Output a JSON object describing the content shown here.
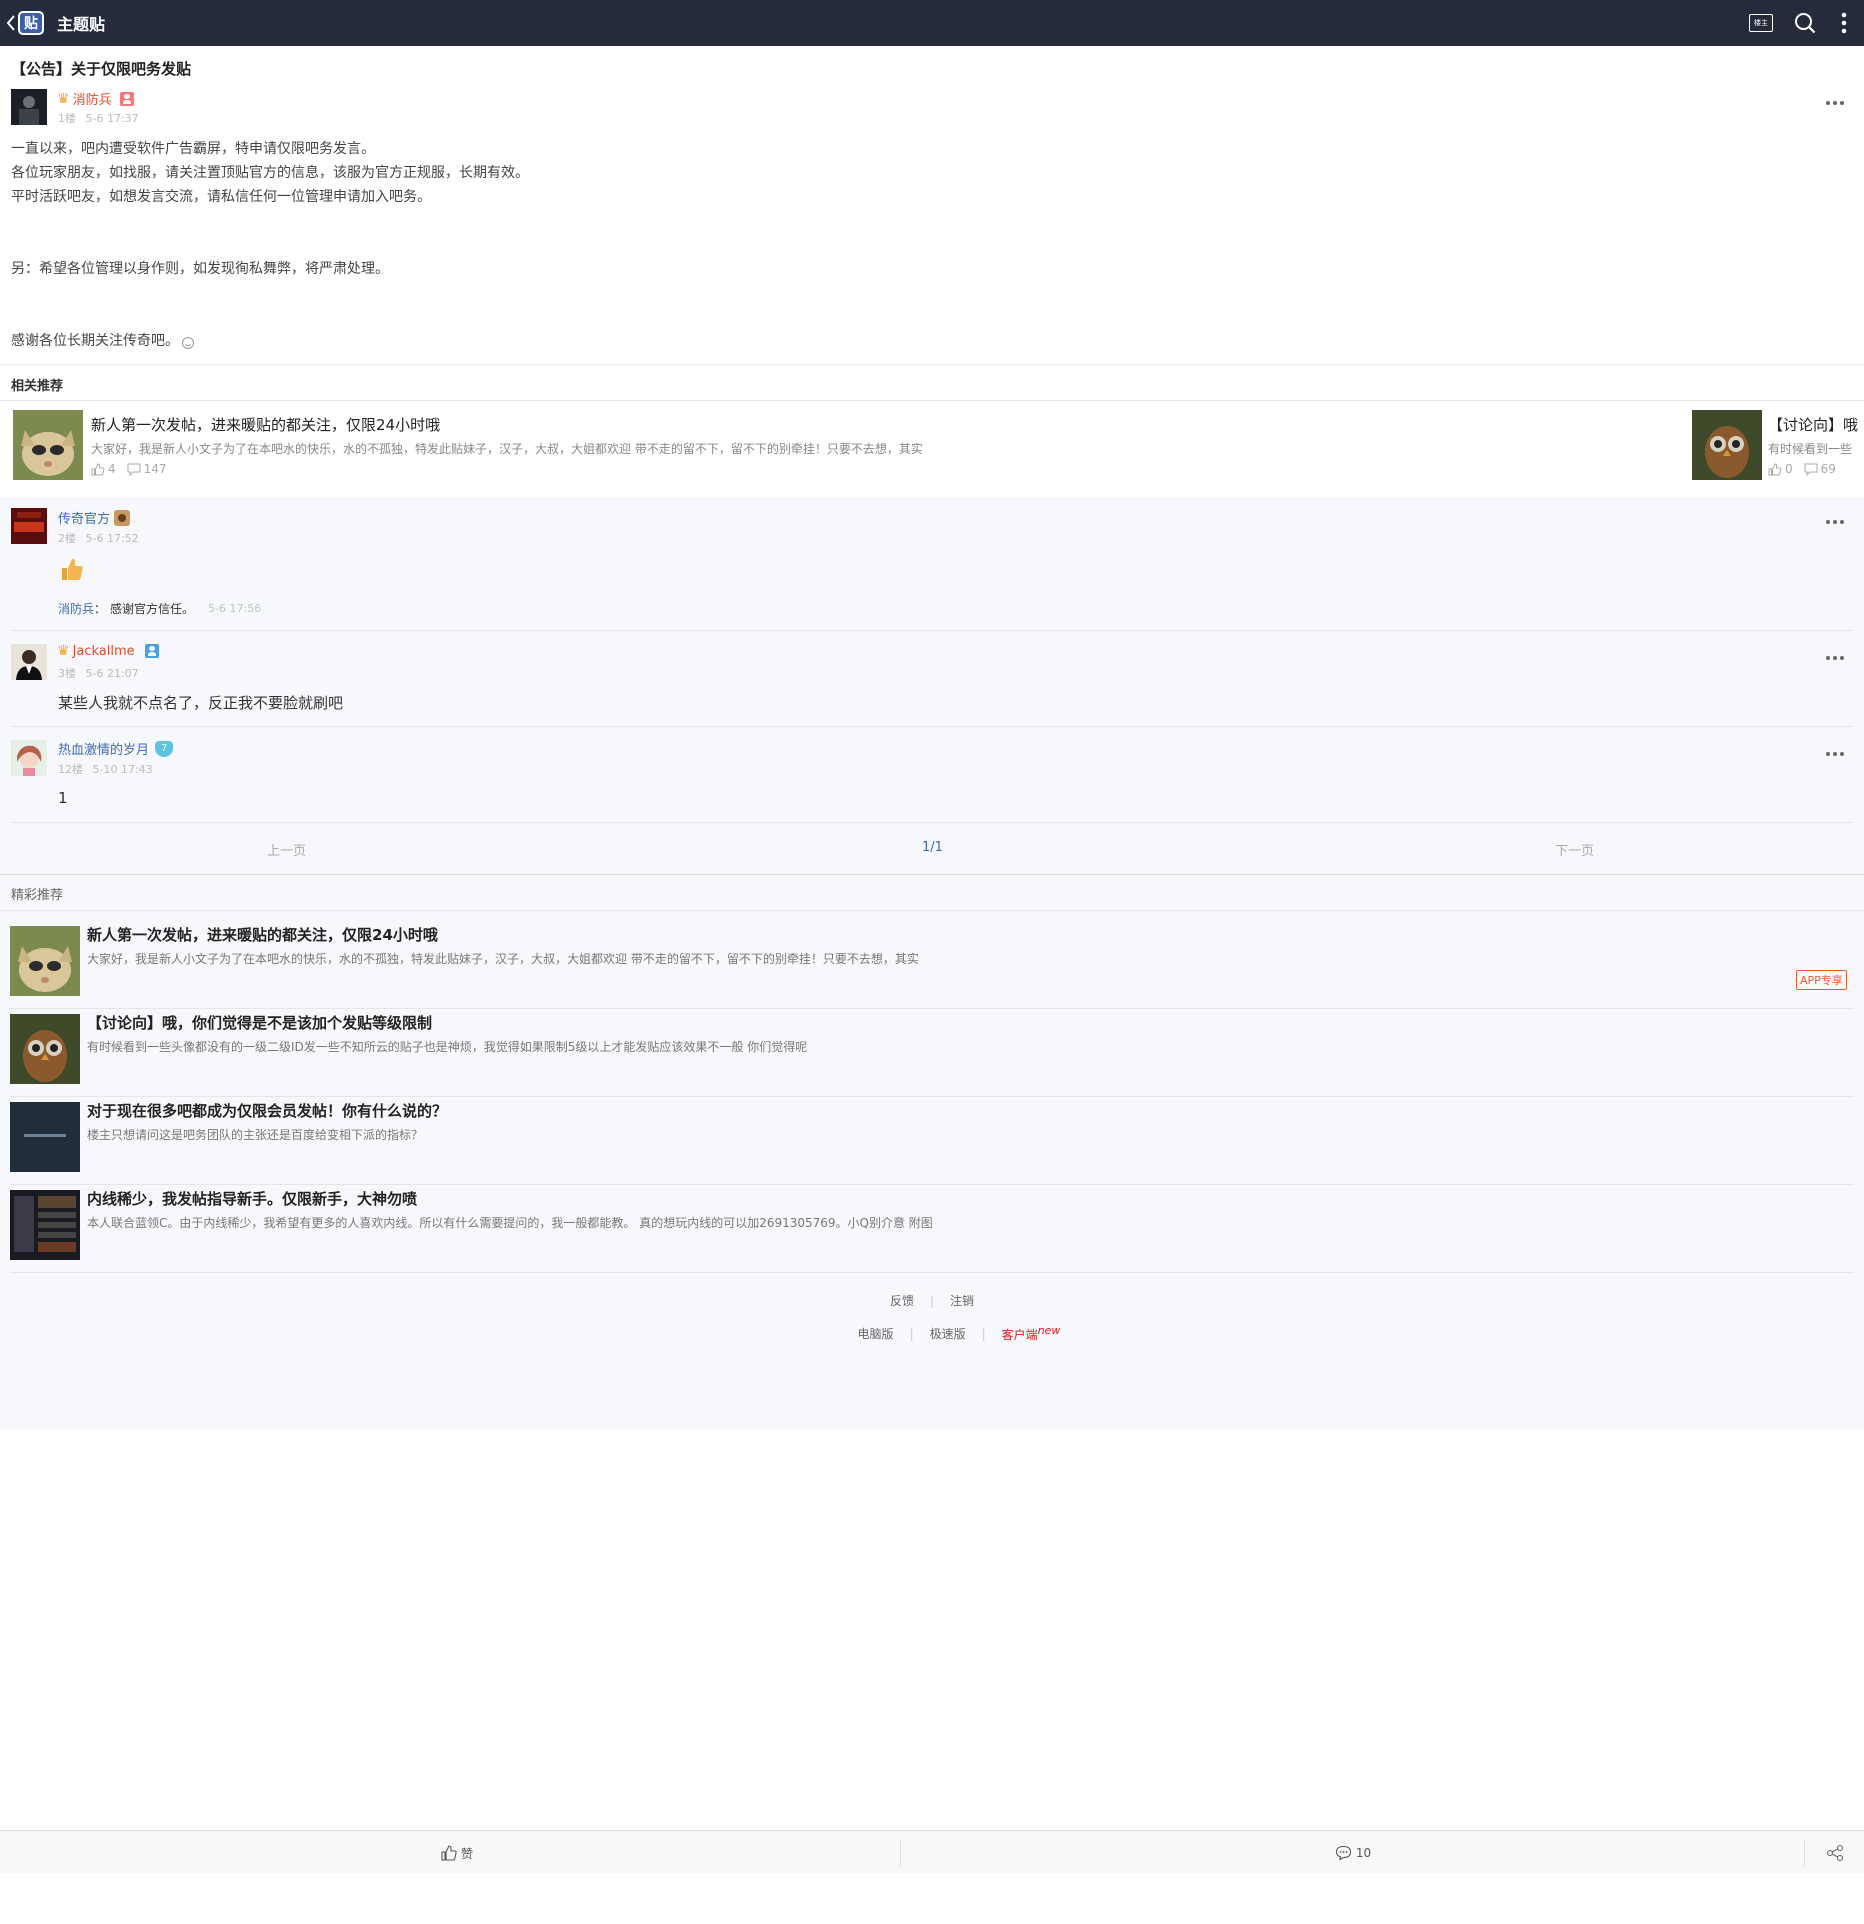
{
  "header": {
    "title": "主题贴",
    "back_logo": "贴",
    "author_only_label": "楼主",
    "icons": [
      "back-icon",
      "author-only-icon",
      "search-icon",
      "more-vertical-icon"
    ]
  },
  "post": {
    "title": "【公告】关于仅限吧务发贴",
    "author": "消防兵",
    "floor": "1楼",
    "time": "5-6 17:37",
    "lines": [
      "一直以来，吧内遭受软件广告霸屏，特申请仅限吧务发言。",
      "各位玩家朋友，如找服，请关注置顶贴官方的信息，该服为官方正规服，长期有效。",
      "平时活跃吧友，如想发言交流，请私信任何一位管理申请加入吧务。",
      "另：希望各位管理以身作则，如发现徇私舞弊，将严肃处理。",
      "感谢各位长期关注传奇吧。"
    ]
  },
  "related": {
    "label": "相关推荐",
    "items": [
      {
        "title": "新人第一次发帖，进来暖贴的都关注，仅限24小时哦",
        "desc": "大家好，我是新人小文子为了在本吧水的快乐，水的不孤独，特发此贴妹子，汉子，大叔，大姐都欢迎 带不走的留不下，留不下的别牵挂！只要不去想，其实",
        "likes": "4",
        "comments": "147"
      },
      {
        "title": "【讨论向】哦",
        "desc": "有时候看到一些",
        "likes": "0",
        "comments": "69"
      }
    ]
  },
  "replies": [
    {
      "author": "传奇官方",
      "floor": "2楼",
      "time": "5-6 17:52",
      "sub_author": "消防兵",
      "sub_sep": "：",
      "sub_text": "感谢官方信任。",
      "sub_time": "5-6 17:56"
    },
    {
      "author": "Jackallme",
      "floor": "3楼",
      "time": "5-6 21:07",
      "text": "某些人我就不点名了，反正我不要脸就刷吧"
    },
    {
      "author": "热血激情的岁月",
      "level": "7",
      "floor": "12楼",
      "time": "5-10 17:43",
      "text": "1"
    }
  ],
  "pager": {
    "prev": "上一页",
    "current": "1/1",
    "next": "下一页"
  },
  "recommend": {
    "label": "精彩推荐",
    "app_badge": "APP专享",
    "items": [
      {
        "title": "新人第一次发帖，进来暖贴的都关注，仅限24小时哦",
        "desc": "大家好，我是新人小文子为了在本吧水的快乐，水的不孤独，特发此贴妹子，汉子，大叔，大姐都欢迎 带不走的留不下，留不下的别牵挂！只要不去想，其实"
      },
      {
        "title": "【讨论向】哦，你们觉得是不是该加个发贴等级限制",
        "desc": "有时候看到一些头像都没有的一级二级ID发一些不知所云的贴子也是神烦，我觉得如果限制5级以上才能发贴应该效果不一般 你们觉得呢"
      },
      {
        "title": "对于现在很多吧都成为仅限会员发帖！你有什么说的？",
        "desc": "楼主只想请问这是吧务团队的主张还是百度给变相下派的指标？"
      },
      {
        "title": "内线稀少，我发帖指导新手。仅限新手，大神勿喷",
        "desc": "本人联合蓝领C。由于内线稀少，我希望有更多的人喜欢内线。所以有什么需要提问的，我一般都能教。 真的想玩内线的可以加2691305769。小Q别介意 附图"
      }
    ]
  },
  "footer": {
    "feedback": "反馈",
    "logout": "注销",
    "pc": "电脑版",
    "lite": "极速版",
    "client": "客户端",
    "client_new": "new",
    "sep": "|"
  },
  "bottom_bar": {
    "like": "赞",
    "comments": "10"
  },
  "colors": {
    "topbar": "#262b3b",
    "author_red": "#e04b2c",
    "author_blue": "#3d6cb0",
    "reply_bg": "#f7f8fc",
    "app_badge": "#f35b2c"
  }
}
